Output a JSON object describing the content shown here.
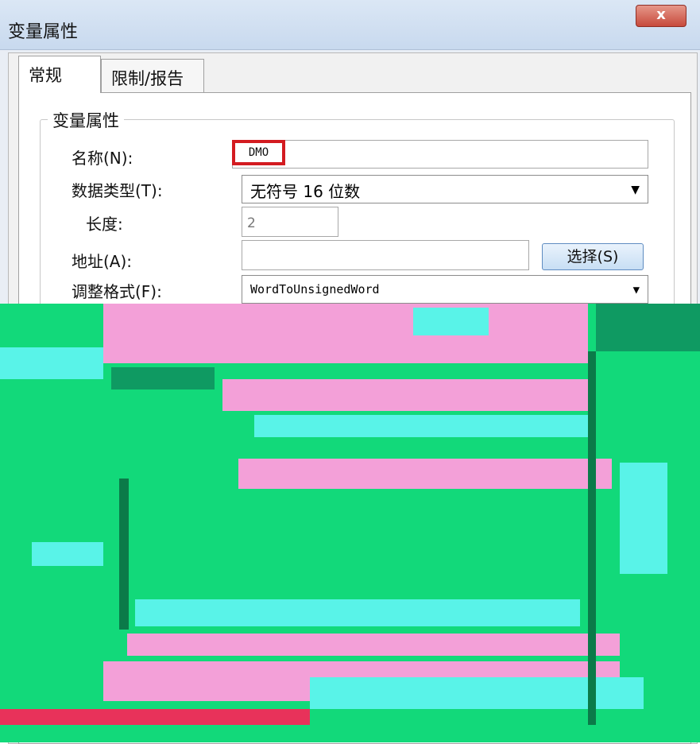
{
  "window": {
    "title": "变量属性",
    "close_glyph": "x"
  },
  "tabs": [
    {
      "label": "常规"
    },
    {
      "label": "限制/报告"
    }
  ],
  "group": {
    "title": "变量属性"
  },
  "fields": {
    "name": {
      "label": "名称(N):",
      "value": "DMO"
    },
    "data_type": {
      "label": "数据类型(T):",
      "value": "无符号 16 位数"
    },
    "length": {
      "label": "长度:",
      "value": "2"
    },
    "address": {
      "label": "地址(A):",
      "value": "",
      "button": "选择(S)"
    },
    "format": {
      "label": "调整格式(F):",
      "value": "WordToUnsignedWord"
    }
  },
  "colors": {
    "highlight": "#d31b20",
    "corrupt_green": "#12d97a",
    "corrupt_pink": "#f3a0d8",
    "corrupt_cyan": "#59f3e8"
  }
}
